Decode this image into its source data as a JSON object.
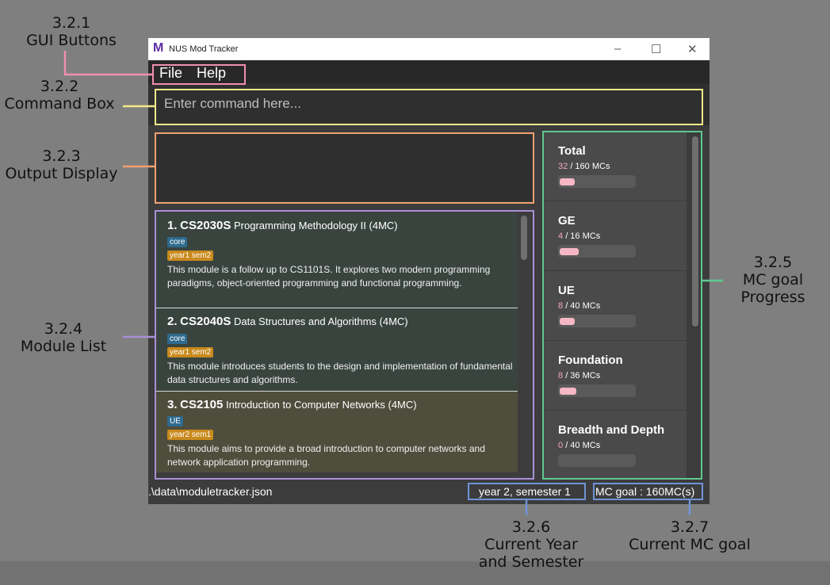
{
  "annotations": {
    "gui_buttons": [
      "3.2.1",
      "GUI Buttons"
    ],
    "command_box": [
      "3.2.2",
      "Command Box"
    ],
    "output_display": [
      "3.2.3",
      "Output Display"
    ],
    "module_list": [
      "3.2.4",
      "Module List"
    ],
    "mc_goal": [
      "3.2.5",
      "MC goal",
      "Progress"
    ],
    "current_year": [
      "3.2.6",
      "Current Year",
      "and Semester"
    ],
    "current_mc_goal": [
      "3.2.7",
      "Current MC goal"
    ]
  },
  "window": {
    "title": "NUS Mod Tracker",
    "logo": "M"
  },
  "menu": {
    "file": "File",
    "help": "Help"
  },
  "command": {
    "placeholder": "Enter command here..."
  },
  "modules": [
    {
      "index": "1.",
      "code": "CS2030S",
      "name": "Programming Methodology II",
      "mc": "(4MC)",
      "tag1": "core",
      "tag2": "year1 sem2",
      "desc": "This module is a follow up to CS1101S. It explores two modern programming paradigms, object-oriented programming and functional programming."
    },
    {
      "index": "2.",
      "code": "CS2040S",
      "name": "Data Structures and Algorithms",
      "mc": "(4MC)",
      "tag1": "core",
      "tag2": "year1 sem2",
      "desc": "This module introduces students to the design and implementation of fundamental data structures and algorithms."
    },
    {
      "index": "3.",
      "code": "CS2105",
      "name": "Introduction to Computer Networks",
      "mc": "(4MC)",
      "tag1": "UE",
      "tag2": "year2 sem1",
      "desc": "This module aims to provide a broad introduction to computer networks and network application programming."
    }
  ],
  "mc_progress": [
    {
      "name": "Total",
      "done": "32",
      "goal": "/ 160 MCs",
      "progress": 0.2
    },
    {
      "name": "GE",
      "done": "4",
      "goal": "/ 16 MCs",
      "progress": 0.25
    },
    {
      "name": "UE",
      "done": "8",
      "goal": "/ 40 MCs",
      "progress": 0.2
    },
    {
      "name": "Foundation",
      "done": "8",
      "goal": "/ 36 MCs",
      "progress": 0.22
    },
    {
      "name": "Breadth and Depth",
      "done": "0",
      "goal": "/ 40 MCs",
      "progress": 0
    }
  ],
  "status": {
    "path": ".\\data\\moduletracker.json",
    "year_sem": "year 2,   semester 1",
    "mc_goal": "MC goal : 160MC(s)"
  },
  "colors": {
    "gui_buttons": "#f08fb2",
    "command_box": "#f2e98a",
    "output_display": "#f0a070",
    "module_list": "#a98fd6",
    "mc_goal": "#5fc98f",
    "status": "#6f93d6",
    "tag_core": "#2f6b8f",
    "tag_sem": "#c98a1d"
  }
}
